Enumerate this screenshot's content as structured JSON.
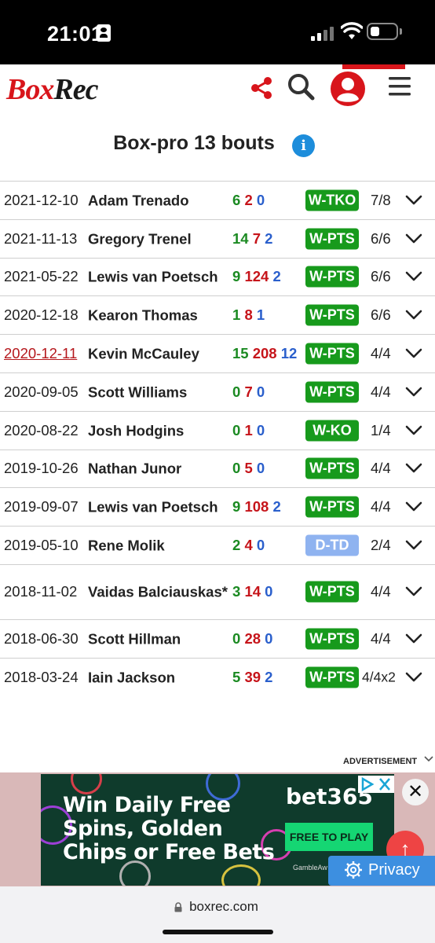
{
  "status_bar": {
    "time": "21:01"
  },
  "header": {
    "logo_box": "Box",
    "logo_rec": "Rec"
  },
  "page": {
    "title": "Box-pro 13 bouts"
  },
  "bouts": [
    {
      "date": "2021-12-10",
      "opponent": "Adam Trenado",
      "w": "6",
      "l": "2",
      "d": "0",
      "result": "W-TKO",
      "rounds": "7/8"
    },
    {
      "date": "2021-11-13",
      "opponent": "Gregory Trenel",
      "w": "14",
      "l": "7",
      "d": "2",
      "result": "W-PTS",
      "rounds": "6/6"
    },
    {
      "date": "2021-05-22",
      "opponent": "Lewis van Poetsch",
      "w": "9",
      "l": "124",
      "d": "2",
      "result": "W-PTS",
      "rounds": "6/6"
    },
    {
      "date": "2020-12-18",
      "opponent": "Kearon Thomas",
      "w": "1",
      "l": "8",
      "d": "1",
      "result": "W-PTS",
      "rounds": "6/6"
    },
    {
      "date": "2020-12-11",
      "opponent": "Kevin McCauley",
      "w": "15",
      "l": "208",
      "d": "12",
      "result": "W-PTS",
      "rounds": "4/4"
    },
    {
      "date": "2020-09-05",
      "opponent": "Scott Williams",
      "w": "0",
      "l": "7",
      "d": "0",
      "result": "W-PTS",
      "rounds": "4/4"
    },
    {
      "date": "2020-08-22",
      "opponent": "Josh Hodgins",
      "w": "0",
      "l": "1",
      "d": "0",
      "result": "W-KO",
      "rounds": "1/4"
    },
    {
      "date": "2019-10-26",
      "opponent": "Nathan Junor",
      "w": "0",
      "l": "5",
      "d": "0",
      "result": "W-PTS",
      "rounds": "4/4"
    },
    {
      "date": "2019-09-07",
      "opponent": "Lewis van Poetsch",
      "w": "9",
      "l": "108",
      "d": "2",
      "result": "W-PTS",
      "rounds": "4/4"
    },
    {
      "date": "2019-05-10",
      "opponent": "Rene Molik",
      "w": "2",
      "l": "4",
      "d": "0",
      "result": "D-TD",
      "rounds": "2/4"
    },
    {
      "date": "2018-11-02",
      "opponent": "Vaidas Balciauskas*",
      "w": "3",
      "l": "14",
      "d": "0",
      "result": "W-PTS",
      "rounds": "4/4"
    },
    {
      "date": "2018-06-30",
      "opponent": "Scott Hillman",
      "w": "0",
      "l": "28",
      "d": "0",
      "result": "W-PTS",
      "rounds": "4/4"
    },
    {
      "date": "2018-03-24",
      "opponent": "Iain Jackson",
      "w": "5",
      "l": "39",
      "d": "2",
      "result": "W-PTS",
      "rounds": "4/4x2"
    }
  ],
  "ad": {
    "label": "ADVERTISEMENT",
    "headline_1": "Win Daily Free",
    "headline_2": "Spins, Golden",
    "headline_3": "Chips or Free Bets",
    "brand": "bet365",
    "cta": "FREE TO PLAY",
    "small_print": "GambleAw",
    "close": "✕"
  },
  "privacy": {
    "label": "Privacy"
  },
  "browser": {
    "url": "boxrec.com"
  },
  "colors": {
    "brand_red": "#d8151b",
    "win_green": "#179a1c",
    "draw_blue": "#8fb3f0",
    "loss_red": "#c6141a",
    "draw_num_blue": "#2a5fcc"
  }
}
